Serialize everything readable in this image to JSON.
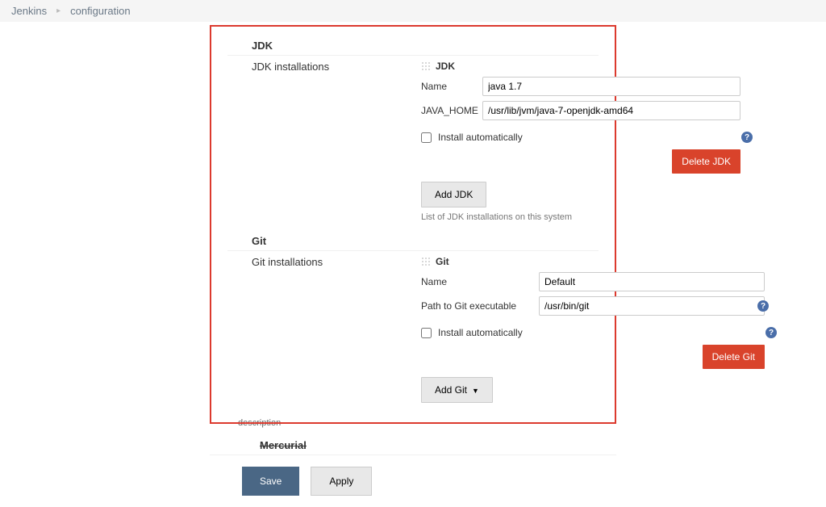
{
  "breadcrumb": {
    "root": "Jenkins",
    "current": "configuration"
  },
  "jdk": {
    "section_title": "JDK",
    "subsection_label": "JDK installations",
    "tool_label": "JDK",
    "fields": {
      "name_label": "Name",
      "name_value": "java 1.7",
      "home_label": "JAVA_HOME",
      "home_value": "/usr/lib/jvm/java-7-openjdk-amd64"
    },
    "install_auto_label": "Install automatically",
    "install_auto_checked": false,
    "delete_button": "Delete JDK",
    "add_button": "Add JDK",
    "helper_text": "List of JDK installations on this system"
  },
  "git": {
    "section_title": "Git",
    "subsection_label": "Git installations",
    "tool_label": "Git",
    "fields": {
      "name_label": "Name",
      "name_value": "Default",
      "path_label": "Path to Git executable",
      "path_value": "/usr/bin/git"
    },
    "install_auto_label": "Install automatically",
    "install_auto_checked": false,
    "delete_button": "Delete Git",
    "add_button": "Add Git"
  },
  "post": {
    "description_label": "description",
    "mercurial_title": "Mercurial"
  },
  "footer": {
    "save": "Save",
    "apply": "Apply"
  }
}
